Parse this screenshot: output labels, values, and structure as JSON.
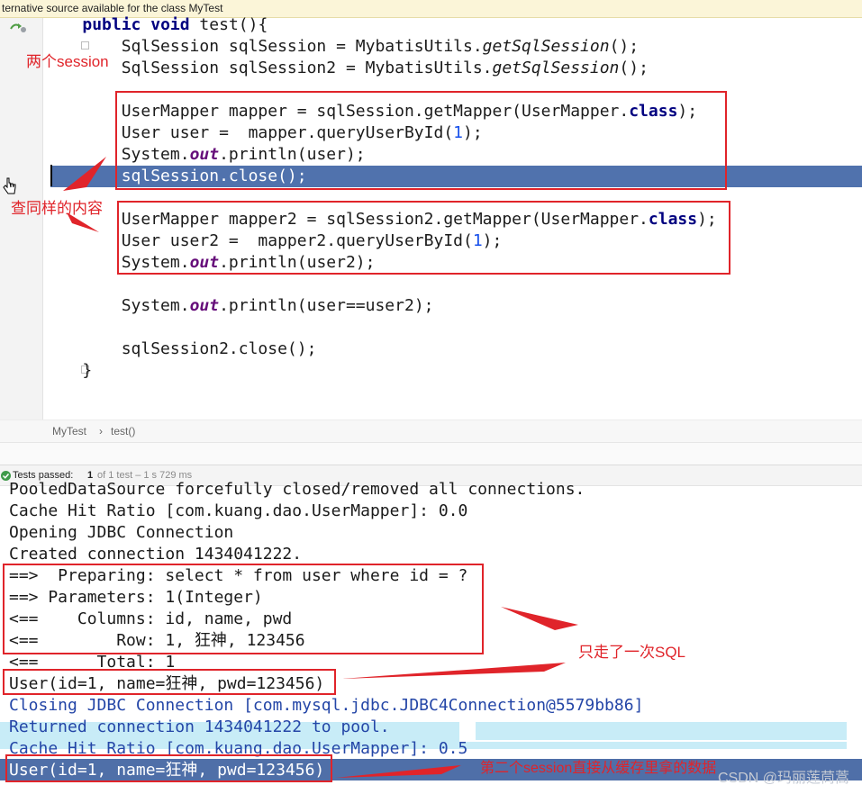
{
  "notice": {
    "text": "ternative source available for the class MyTest"
  },
  "code": {
    "line_signature": "    public void test(){",
    "kw_public": "public",
    "kw_void": "void",
    "sig_name": " test(){",
    "l1a": "        SqlSession sqlSession = MybatisUtils.",
    "l1b": "getSqlSession",
    "l1c": "();",
    "l2a": "        SqlSession sqlSession2 = MybatisUtils.",
    "l2b": "getSqlSession",
    "l2c": "();",
    "l3a": "        UserMapper mapper = sqlSession.getMapper(UserMapper.",
    "l3b": "class",
    "l3c": ");",
    "l4a": "        User user =  mapper.queryUserById(",
    "l4b": "1",
    "l4c": ");",
    "l5a": "        System.",
    "l5b": "out",
    "l5c": ".println(user);",
    "l6": "        sqlSession.close();",
    "l7a": "        UserMapper mapper2 = sqlSession2.getMapper(UserMapper.",
    "l7b": "class",
    "l7c": ");",
    "l8a": "        User user2 =  mapper2.queryUserById(",
    "l8b": "1",
    "l8c": ");",
    "l9a": "        System.",
    "l9b": "out",
    "l9c": ".println(user2);",
    "l10a": "        System.",
    "l10b": "out",
    "l10c": ".println(user==user2);",
    "l11": "        sqlSession2.close();",
    "l12": "    }"
  },
  "breadcrumb": {
    "class": "MyTest",
    "sep": "›",
    "method": "test()"
  },
  "testbar": {
    "label": "Tests passed:",
    "count": "1",
    "detail": "of 1 test – 1 s 729 ms"
  },
  "console": {
    "c0": "PooledDataSource forcefully closed/removed all connections.",
    "c1": "Cache Hit Ratio [com.kuang.dao.UserMapper]: 0.0",
    "c2": "Opening JDBC Connection",
    "c3": "Created connection 1434041222.",
    "c4": "==>  Preparing: select * from user where id = ?",
    "c5": "==> Parameters: 1(Integer)",
    "c6": "<==    Columns: id, name, pwd",
    "c7": "<==        Row: 1, 狂神, 123456",
    "c8": "<==      Total: 1",
    "c9": "User(id=1, name=狂神, pwd=123456)",
    "c10": "Closing JDBC Connection [com.mysql.jdbc.JDBC4Connection@5579bb86]",
    "c11": "Returned connection 1434041222 to pool.",
    "c12": "Cache Hit Ratio [com.kuang.dao.UserMapper]: 0.5",
    "c13": "User(id=1, name=狂神, pwd=123456)"
  },
  "annotations": {
    "two_sessions": "两个session",
    "same_query": "查同样的内容",
    "one_sql": "只走了一次SQL",
    "cache_note": "第二个session直接从缓存里拿的数据"
  },
  "watermark": "CSDN @玛丽莲茼蒿",
  "colors": {
    "annotation_red": "#e0242a",
    "selection_blue": "#5072ad",
    "keyword_navy": "#000080"
  }
}
